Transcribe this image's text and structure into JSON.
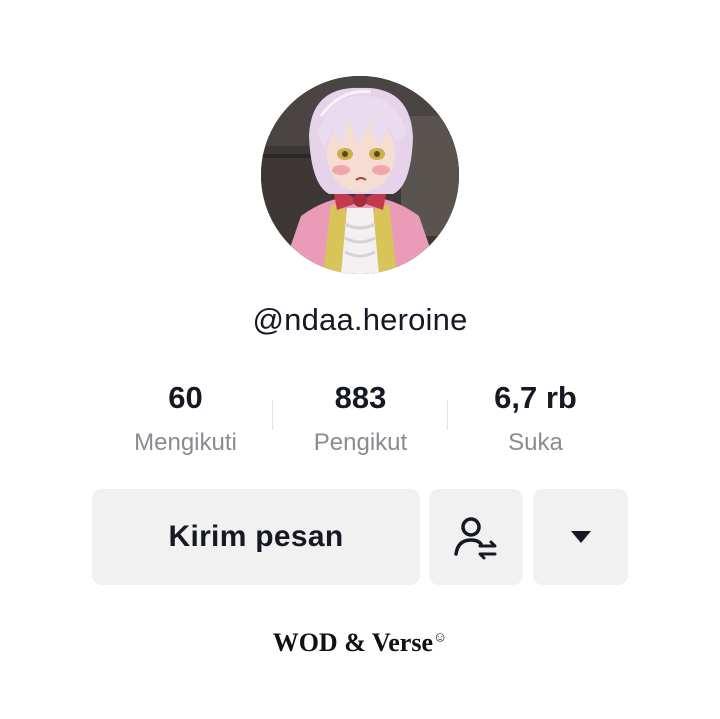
{
  "profile": {
    "username": "@ndaa.heroine"
  },
  "stats": [
    {
      "value": "60",
      "label": "Mengikuti"
    },
    {
      "value": "883",
      "label": "Pengikut"
    },
    {
      "value": "6,7 rb",
      "label": "Suka"
    }
  ],
  "actions": {
    "message_label": "Kirim pesan",
    "friend_icon": "user-swap-icon",
    "more_icon": "caret-down-icon"
  },
  "watermark": {
    "text": "WOD & Verse",
    "mark": "☺"
  },
  "colors": {
    "text": "#161823",
    "muted": "#8a8b91",
    "button_bg": "#f1f1f2"
  }
}
